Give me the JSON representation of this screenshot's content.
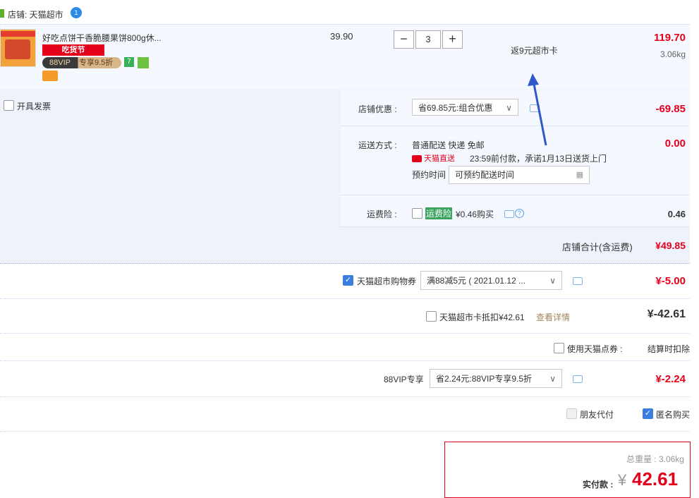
{
  "shop": {
    "label": "店铺: 天猫超市",
    "badge": "1"
  },
  "item": {
    "title": "好吃点饼干香脆腰果饼800g休...",
    "tag": "吃货节",
    "vip_left": "88VIP",
    "vip_right": "专享9.5折",
    "green_tag": "7",
    "unit_price": "39.90",
    "qty_minus": "−",
    "qty_value": "3",
    "qty_plus": "+",
    "rebate": "返9元超市卡",
    "subtotal": "119.70",
    "weight": "3.06kg"
  },
  "invoice_label": "开具发票",
  "store_discount": {
    "label": "店铺优惠 :",
    "value": "省69.85元:组合优惠",
    "amount": "-69.85"
  },
  "shipping": {
    "label": "运送方式 :",
    "method": "普通配送 快递 免邮",
    "tm_direct": "天猫直送",
    "promise": "23:59前付款，承诺1月13日送货上门",
    "schedule_label": "预约时间",
    "schedule_placeholder": "可预约配送时间",
    "amount": "0.00"
  },
  "insurance": {
    "label": "运费险 :",
    "tag": "运费险",
    "text": "¥0.46购买",
    "help": "?",
    "amount": "0.46"
  },
  "store_total": {
    "label": "店铺合计(含运费)",
    "amount": "¥49.85"
  },
  "coupon": {
    "label": "天猫超市购物券",
    "value": "满88减5元 ( 2021.01.12 ...",
    "amount": "¥-5.00"
  },
  "card": {
    "label": "天猫超市卡抵扣¥42.61",
    "link": "查看详情",
    "amount": "¥-42.61"
  },
  "points": {
    "label": "使用天猫点券 :",
    "right": "结算时扣除"
  },
  "vip": {
    "label": "88VIP专享",
    "value": "省2.24元:88VIP专享9.5折",
    "amount": "¥-2.24"
  },
  "friend_pay": "朋友代付",
  "anon_buy": "匿名购买",
  "summary": {
    "weight_label": "总重量 : 3.06kg",
    "pay_label": "实付款 :",
    "currency": "¥",
    "pay_amount": "42.61"
  },
  "colors": {
    "accent_red": "#e4001b",
    "blue": "#3b7ee0",
    "panel_bg": "#eef3fb"
  }
}
